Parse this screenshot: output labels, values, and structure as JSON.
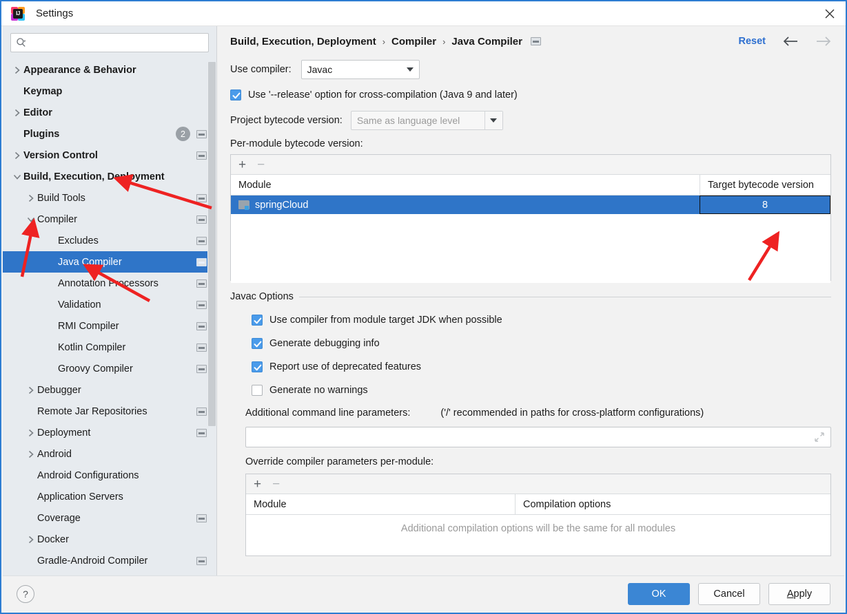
{
  "window": {
    "title": "Settings",
    "app_icon": "intellij-idea-icon",
    "close_icon": "close-icon"
  },
  "sidebar": {
    "search": {
      "placeholder": "",
      "value": "",
      "icon": "search-icon"
    },
    "items": [
      {
        "label": "Appearance & Behavior",
        "level": 0,
        "twisty": "collapsed",
        "gear": false,
        "selected": false
      },
      {
        "label": "Keymap",
        "level": 0,
        "twisty": "none",
        "gear": false,
        "selected": false
      },
      {
        "label": "Editor",
        "level": 0,
        "twisty": "collapsed",
        "gear": false,
        "selected": false
      },
      {
        "label": "Plugins",
        "level": 0,
        "twisty": "none",
        "gear": true,
        "badge": "2",
        "selected": false
      },
      {
        "label": "Version Control",
        "level": 0,
        "twisty": "collapsed",
        "gear": true,
        "selected": false
      },
      {
        "label": "Build, Execution, Deployment",
        "level": 0,
        "twisty": "expanded",
        "gear": false,
        "selected": false
      },
      {
        "label": "Build Tools",
        "level": 1,
        "twisty": "collapsed",
        "gear": true,
        "selected": false
      },
      {
        "label": "Compiler",
        "level": 1,
        "twisty": "expanded",
        "gear": true,
        "selected": false
      },
      {
        "label": "Excludes",
        "level": 2,
        "twisty": "none",
        "gear": true,
        "selected": false
      },
      {
        "label": "Java Compiler",
        "level": 2,
        "twisty": "none",
        "gear": true,
        "selected": true
      },
      {
        "label": "Annotation Processors",
        "level": 2,
        "twisty": "none",
        "gear": true,
        "selected": false
      },
      {
        "label": "Validation",
        "level": 2,
        "twisty": "none",
        "gear": true,
        "selected": false
      },
      {
        "label": "RMI Compiler",
        "level": 2,
        "twisty": "none",
        "gear": true,
        "selected": false
      },
      {
        "label": "Kotlin Compiler",
        "level": 2,
        "twisty": "none",
        "gear": true,
        "selected": false
      },
      {
        "label": "Groovy Compiler",
        "level": 2,
        "twisty": "none",
        "gear": true,
        "selected": false
      },
      {
        "label": "Debugger",
        "level": 1,
        "twisty": "collapsed",
        "gear": false,
        "selected": false
      },
      {
        "label": "Remote Jar Repositories",
        "level": 1,
        "twisty": "none",
        "gear": true,
        "selected": false
      },
      {
        "label": "Deployment",
        "level": 1,
        "twisty": "collapsed",
        "gear": true,
        "selected": false
      },
      {
        "label": "Android",
        "level": 1,
        "twisty": "collapsed",
        "gear": false,
        "selected": false
      },
      {
        "label": "Android Configurations",
        "level": 1,
        "twisty": "none",
        "gear": false,
        "selected": false
      },
      {
        "label": "Application Servers",
        "level": 1,
        "twisty": "none",
        "gear": false,
        "selected": false
      },
      {
        "label": "Coverage",
        "level": 1,
        "twisty": "none",
        "gear": true,
        "selected": false
      },
      {
        "label": "Docker",
        "level": 1,
        "twisty": "collapsed",
        "gear": false,
        "selected": false
      },
      {
        "label": "Gradle-Android Compiler",
        "level": 1,
        "twisty": "none",
        "gear": true,
        "selected": false
      }
    ]
  },
  "header": {
    "breadcrumb": [
      "Build, Execution, Deployment",
      "Compiler",
      "Java Compiler"
    ],
    "separator": "›",
    "gear_icon": "project-settings-icon",
    "reset_label": "Reset",
    "back_icon": "arrow-left-icon",
    "forward_icon": "arrow-right-icon",
    "accent_color": "#2d6fd0"
  },
  "main": {
    "use_compiler_label": "Use compiler:",
    "use_compiler_value": "Javac",
    "release_option": {
      "label": "Use '--release' option for cross-compilation (Java 9 and later)",
      "checked": true
    },
    "project_bytecode_label": "Project bytecode version:",
    "project_bytecode_value": "Same as language level",
    "per_module_label": "Per-module bytecode version:",
    "module_table": {
      "add_label": "+",
      "remove_label": "−",
      "columns": [
        "Module",
        "Target bytecode version"
      ],
      "rows": [
        {
          "module": "springCloud",
          "target": "8",
          "selected": true,
          "editing": true
        }
      ]
    },
    "javac_group_title": "Javac Options",
    "javac_options": [
      {
        "label": "Use compiler from module target JDK when possible",
        "checked": true
      },
      {
        "label": "Generate debugging info",
        "checked": true
      },
      {
        "label": "Report use of deprecated features",
        "checked": true
      },
      {
        "label": "Generate no warnings",
        "checked": false
      }
    ],
    "additional_params_label": "Additional command line parameters:",
    "additional_params_hint": "('/' recommended in paths for cross-platform configurations)",
    "additional_params_value": "",
    "expand_icon": "expand-icon",
    "override_label": "Override compiler parameters per-module:",
    "override_table": {
      "add_label": "+",
      "remove_label": "−",
      "columns": [
        "Module",
        "Compilation options"
      ],
      "empty_message": "Additional compilation options will be the same for all modules"
    }
  },
  "footer": {
    "help_label": "?",
    "ok_label": "OK",
    "cancel_label": "Cancel",
    "apply_label_prefix": "A",
    "apply_label_rest": "pply"
  },
  "annotations": {
    "color": "#ee2222",
    "arrows": 3
  }
}
